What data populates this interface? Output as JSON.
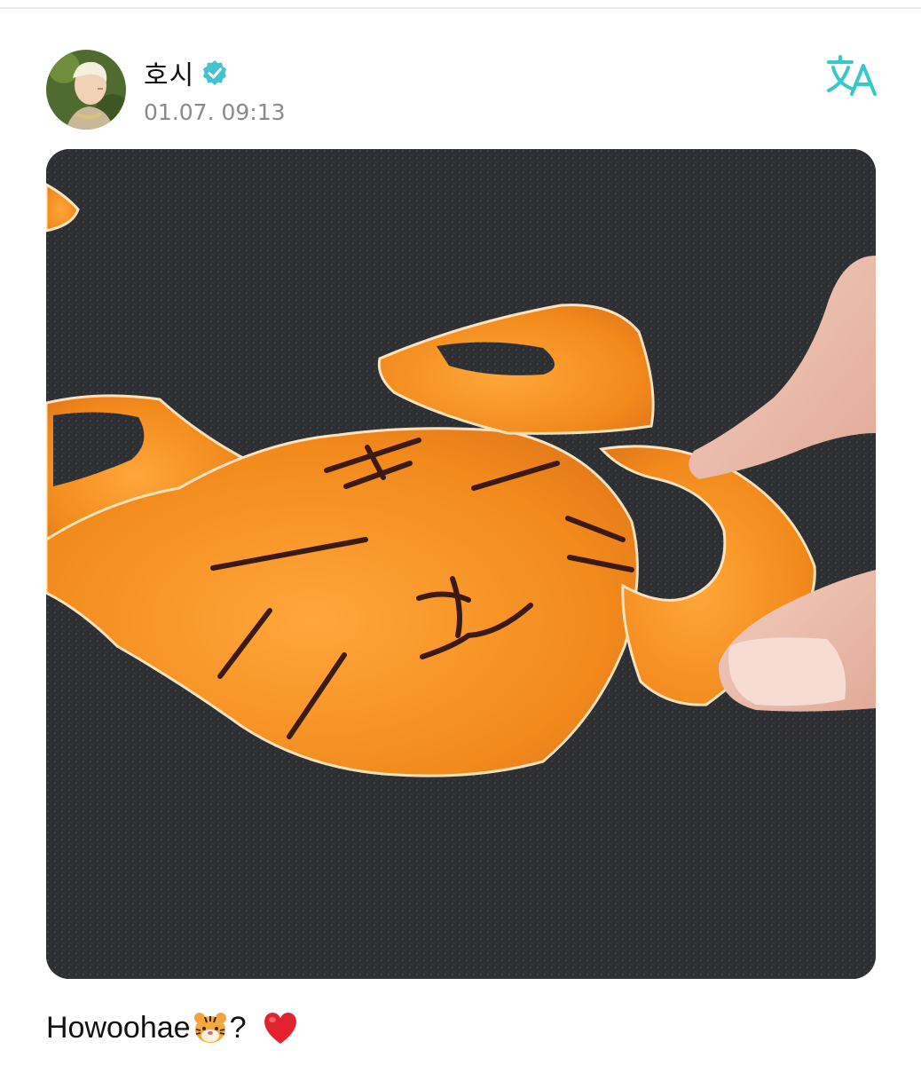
{
  "post": {
    "author": {
      "name": "호시",
      "verified": true,
      "avatar": "avatar"
    },
    "timestamp": "01.07. 09:13",
    "translate_icon": "translate-icon",
    "photo": {
      "description_icon": "photo",
      "drawn_text": ""
    },
    "caption": {
      "text": "Howoohae",
      "after_emoji": "?",
      "emojis": [
        "tiger-face-icon",
        "red-heart-icon"
      ]
    }
  },
  "colors": {
    "accent": "#37c8c9",
    "verified": "#43c3cf",
    "timestamp": "#8a8a8a",
    "peel": "#f28a1c",
    "background_fabric": "#2d2e31"
  }
}
